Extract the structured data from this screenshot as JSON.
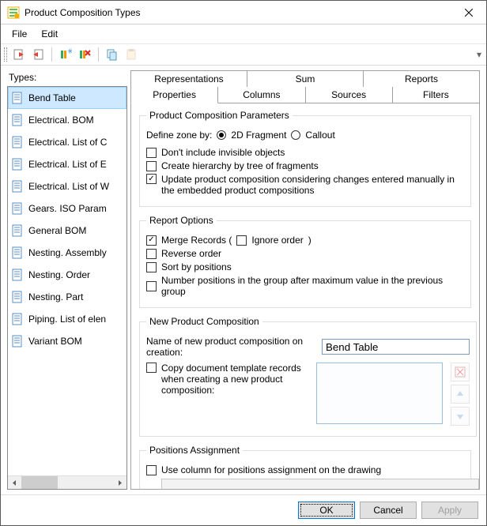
{
  "window": {
    "title": "Product Composition Types"
  },
  "menu": {
    "file": "File",
    "edit": "Edit"
  },
  "toolbar_icons": [
    "import",
    "export",
    "add",
    "delete",
    "copy",
    "paste"
  ],
  "left_panel": {
    "label": "Types:",
    "items": [
      "Bend Table",
      "Electrical. BOM",
      "Electrical. List of C",
      "Electrical. List of E",
      "Electrical. List of W",
      "Gears. ISO Param",
      "General BOM",
      "Nesting. Assembly",
      "Nesting. Order",
      "Nesting. Part",
      "Piping. List of elen",
      "Variant BOM"
    ],
    "selected_index": 0
  },
  "tabs_top": [
    "Representations",
    "Sum",
    "Reports"
  ],
  "tabs_bottom": [
    "Properties",
    "Columns",
    "Sources",
    "Filters"
  ],
  "tabs_active": "Properties",
  "section_params": {
    "legend": "Product Composition Parameters",
    "define_zone_label": "Define zone by:",
    "radio_2d": "2D Fragment",
    "radio_callout": "Callout",
    "radio_selected": "2d",
    "chk_dont_include": "Don't include invisible objects",
    "chk_hierarchy": "Create hierarchy by tree of fragments",
    "chk_update": "Update product composition considering changes entered manually in the embedded product compositions",
    "chk_dont_include_val": false,
    "chk_hierarchy_val": false,
    "chk_update_val": true
  },
  "section_report": {
    "legend": "Report Options",
    "chk_merge": "Merge Records (",
    "chk_ignore": "Ignore order",
    "merge_close": ")",
    "chk_reverse": "Reverse order",
    "chk_sort": "Sort by positions",
    "chk_number": "Number positions in the group after maximum value in the previous group",
    "chk_merge_val": true,
    "chk_ignore_val": false,
    "chk_reverse_val": false,
    "chk_sort_val": false,
    "chk_number_val": false
  },
  "section_new": {
    "legend": "New Product Composition",
    "name_label": "Name of new product composition on creation:",
    "name_value": "Bend Table",
    "copy_label": "Copy document template records when creating a new product composition:",
    "copy_val": false
  },
  "section_positions": {
    "legend": "Positions Assignment",
    "chk_usecol": "Use column for positions assignment on the drawing",
    "chk_usecol_val": false
  },
  "footer": {
    "ok": "OK",
    "cancel": "Cancel",
    "apply": "Apply"
  }
}
